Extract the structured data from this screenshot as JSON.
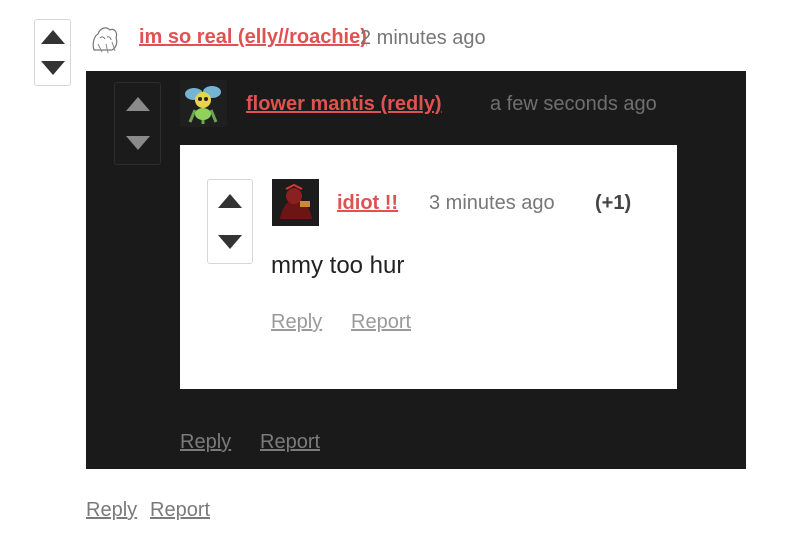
{
  "top_comment": {
    "author": "im so real (elly//roachie)",
    "time": "2 minutes ago",
    "actions": {
      "reply": "Reply",
      "report": "Report"
    }
  },
  "mid_comment": {
    "author": "flower mantis (redly)",
    "time": "a few seconds ago",
    "actions": {
      "reply": "Reply",
      "report": "Report"
    }
  },
  "inner_comment": {
    "author": "idiot !!",
    "time": "3 minutes ago",
    "score": "(+1)",
    "body": "mmy too hur",
    "actions": {
      "reply": "Reply",
      "report": "Report"
    }
  },
  "colors": {
    "link": "#e05151",
    "dark_panel": "#1a1a1a",
    "card": "#ffffff"
  }
}
